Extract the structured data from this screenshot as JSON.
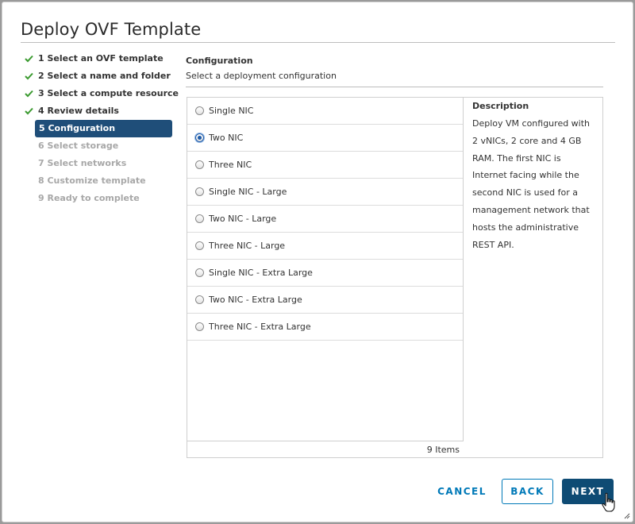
{
  "dialog": {
    "title": "Deploy OVF Template"
  },
  "steps": [
    {
      "label": "1 Select an OVF template",
      "state": "done"
    },
    {
      "label": "2 Select a name and folder",
      "state": "done"
    },
    {
      "label": "3 Select a compute resource",
      "state": "done"
    },
    {
      "label": "4 Review details",
      "state": "done"
    },
    {
      "label": "5 Configuration",
      "state": "active"
    },
    {
      "label": "6 Select storage",
      "state": "todo"
    },
    {
      "label": "7 Select networks",
      "state": "todo"
    },
    {
      "label": "8 Customize template",
      "state": "todo"
    },
    {
      "label": "9 Ready to complete",
      "state": "todo"
    }
  ],
  "configuration": {
    "title": "Configuration",
    "subtitle": "Select a deployment configuration",
    "options": [
      {
        "label": "Single NIC",
        "checked": false
      },
      {
        "label": "Two NIC",
        "checked": true
      },
      {
        "label": "Three NIC",
        "checked": false
      },
      {
        "label": "Single NIC - Large",
        "checked": false
      },
      {
        "label": "Two NIC - Large",
        "checked": false
      },
      {
        "label": "Three NIC - Large",
        "checked": false
      },
      {
        "label": "Single NIC - Extra Large",
        "checked": false
      },
      {
        "label": "Two NIC - Extra Large",
        "checked": false
      },
      {
        "label": "Three NIC - Extra Large",
        "checked": false
      }
    ],
    "footer": "9  Items",
    "description_title": "Description",
    "description_text": "Deploy VM configured with 2 vNICs, 2 core and 4 GB RAM. The first NIC is Internet facing while the second NIC is used for a management network that hosts the administrative REST API."
  },
  "buttons": {
    "cancel": "CANCEL",
    "back": "BACK",
    "next": "NEXT"
  },
  "icons": {
    "check": "check-icon",
    "cursor": "hand-pointer-icon",
    "resize": "resize-grip-icon"
  },
  "colors": {
    "active_step": "#1f4e79",
    "check": "#3a9a2f",
    "primary": "#0e4b74",
    "link": "#0079b8"
  }
}
